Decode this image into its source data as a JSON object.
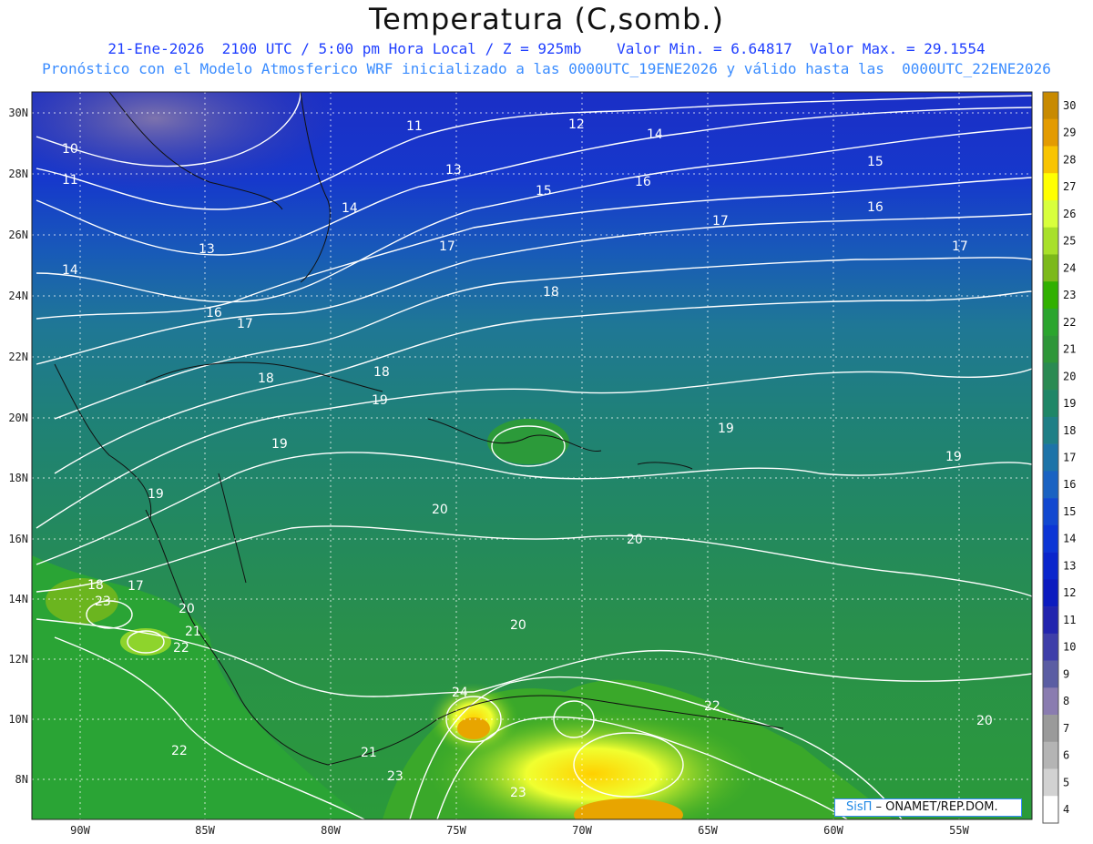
{
  "title": "Temperatura (C,somb.)",
  "subtitle_line1": "21-Ene-2026  2100 UTC / 5:00 pm Hora Local / Z = 925mb    Valor Min. = 6.64817  Valor Max. = 29.1554",
  "subtitle_line2": "Pronóstico con el Modelo Atmosferico WRF inicializado a las 0000UTC_19ENE2026 y válido hasta las  0000UTC_22ENE2026",
  "credit": {
    "brand": "SisΠ",
    "text": " – ONAMET/REP.DOM."
  },
  "lat_ticks": [
    "30N",
    "28N",
    "26N",
    "24N",
    "22N",
    "20N",
    "18N",
    "16N",
    "14N",
    "12N",
    "10N",
    "8N"
  ],
  "lon_ticks": [
    "90W",
    "85W",
    "80W",
    "75W",
    "70W",
    "65W",
    "60W",
    "55W"
  ],
  "colorbar": {
    "labels": [
      "30",
      "29",
      "28",
      "27",
      "26",
      "25",
      "24",
      "23",
      "22",
      "21",
      "20",
      "19",
      "18",
      "17",
      "16",
      "15",
      "14",
      "13",
      "12",
      "11",
      "10",
      "9",
      "8",
      "7",
      "6",
      "5",
      "4"
    ],
    "colors": [
      "#c88a00",
      "#e39b00",
      "#f8c400",
      "#ffff00",
      "#d8ff3c",
      "#a8e02a",
      "#7cb91a",
      "#31b000",
      "#2ba52e",
      "#2e9638",
      "#2a8a52",
      "#1f8667",
      "#1f7f86",
      "#1d73a8",
      "#1a62c2",
      "#1248d0",
      "#0c35d5",
      "#0a25cc",
      "#0c1bbf",
      "#2224ae",
      "#3e3ea9",
      "#5b5da3",
      "#8a7cb0",
      "#9a9a9a",
      "#b4b4b4",
      "#d2d2d2",
      "#ffffff"
    ]
  },
  "contour_labels": [
    {
      "t": "10"
    },
    {
      "t": "11"
    },
    {
      "t": "11"
    },
    {
      "t": "12"
    },
    {
      "t": "14"
    },
    {
      "t": "13"
    },
    {
      "t": "15"
    },
    {
      "t": "16"
    },
    {
      "t": "15"
    },
    {
      "t": "14"
    },
    {
      "t": "16"
    },
    {
      "t": "17"
    },
    {
      "t": "13"
    },
    {
      "t": "14"
    },
    {
      "t": "17"
    },
    {
      "t": "17"
    },
    {
      "t": "16"
    },
    {
      "t": "17"
    },
    {
      "t": "18"
    },
    {
      "t": "18"
    },
    {
      "t": "18"
    },
    {
      "t": "19"
    },
    {
      "t": "19"
    },
    {
      "t": "19"
    },
    {
      "t": "19"
    },
    {
      "t": "19"
    },
    {
      "t": "20"
    },
    {
      "t": "20"
    },
    {
      "t": "20"
    },
    {
      "t": "18"
    },
    {
      "t": "17"
    },
    {
      "t": "23"
    },
    {
      "t": "20"
    },
    {
      "t": "21"
    },
    {
      "t": "22"
    },
    {
      "t": "22"
    },
    {
      "t": "21"
    },
    {
      "t": "23"
    },
    {
      "t": "24"
    },
    {
      "t": "23"
    },
    {
      "t": "22"
    },
    {
      "t": "20"
    }
  ]
}
